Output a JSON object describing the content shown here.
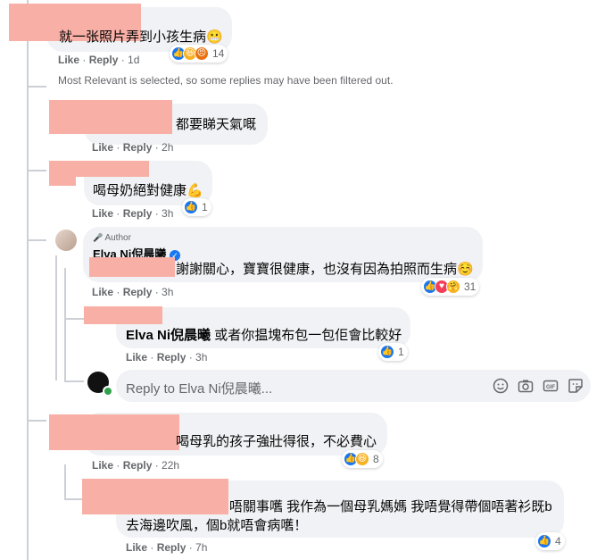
{
  "comments": [
    {
      "text": "就一张照片弄到小孩生病",
      "emoji": "😬",
      "like_label": "Like",
      "reply_label": "Reply",
      "time": "1d",
      "reaction_count": "14"
    },
    {
      "text": "都要睇天氣嘅",
      "like_label": "Like",
      "reply_label": "Reply",
      "time": "2h"
    },
    {
      "text": "喝母奶絕對健康",
      "emoji": "💪",
      "like_label": "Like",
      "reply_label": "Reply",
      "time": "3h",
      "reaction_count": "1"
    },
    {
      "badge": "Author",
      "author": "Elva Ni倪晨曦",
      "text": "謝謝關心，寶寶很健康，也沒有因為拍照而生病",
      "emoji": "☺️",
      "like_label": "Like",
      "reply_label": "Reply",
      "time": "3h",
      "reaction_count": "31"
    },
    {
      "author": "Elva Ni倪晨曦",
      "text": "或者你揾塊布包一包佢會比較好",
      "like_label": "Like",
      "reply_label": "Reply",
      "time": "3h",
      "reaction_count": "1"
    },
    {
      "text": "喝母乳的孩子強壯得很，不必費心",
      "like_label": "Like",
      "reply_label": "Reply",
      "time": "22h",
      "reaction_count": "8"
    },
    {
      "text_line1": "唔關事嚿 我作為一個母乳媽媽 我唔覺得帶個唔著衫既b",
      "text_line2": "去海邊吹風，個b就唔會病嚿！",
      "like_label": "Like",
      "reply_label": "Reply",
      "time": "7h",
      "reaction_count": "4"
    }
  ],
  "filter_notice": "Most Relevant is selected, so some replies may have been filtered out.",
  "reply_input": {
    "placeholder": "Reply to Elva Ni倪晨曦..."
  },
  "colors": {
    "bubble": "#f0f2f5",
    "redaction": "#f8b0a6",
    "link_blue": "#1877f2",
    "meta_gray": "#65676b"
  }
}
